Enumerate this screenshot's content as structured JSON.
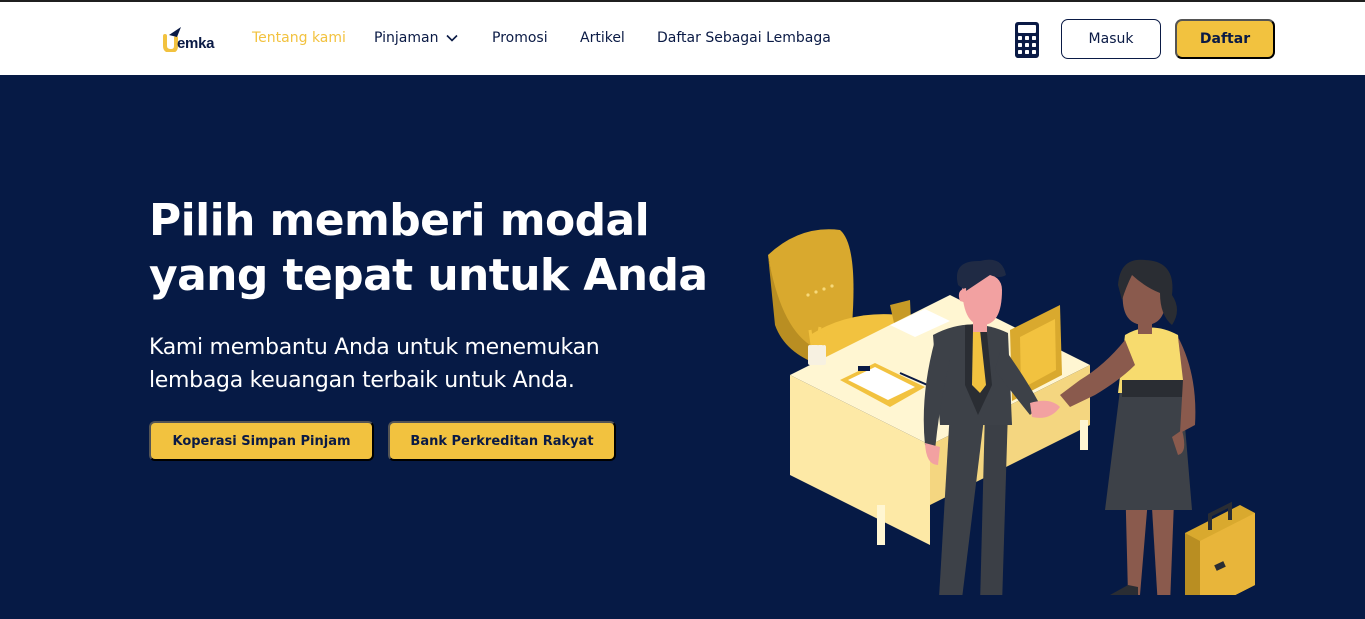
{
  "brand": {
    "logo_text": "emka"
  },
  "nav": {
    "items": [
      {
        "label": "Tentang kami",
        "active": true
      },
      {
        "label": "Pinjaman",
        "has_dropdown": true
      },
      {
        "label": "Promosi"
      },
      {
        "label": "Artikel"
      },
      {
        "label": "Daftar Sebagai Lembaga"
      }
    ],
    "calculator_icon": "calculator-icon",
    "login_label": "Masuk",
    "register_label": "Daftar"
  },
  "hero": {
    "title_line1": "Pilih memberi modal",
    "title_line2": "yang tepat untuk Anda",
    "subtitle_line1": "Kami membantu Anda untuk menemukan",
    "subtitle_line2": "lembaga keuangan terbaik untuk Anda.",
    "buttons": [
      {
        "label": "Koperasi Simpan Pinjam"
      },
      {
        "label": "Bank Perkreditan Rakyat"
      }
    ],
    "illustration": "business-handshake-illustration"
  },
  "colors": {
    "accent": "#f2c23f",
    "navy": "#061a45",
    "text_dark": "#0a1a45"
  }
}
